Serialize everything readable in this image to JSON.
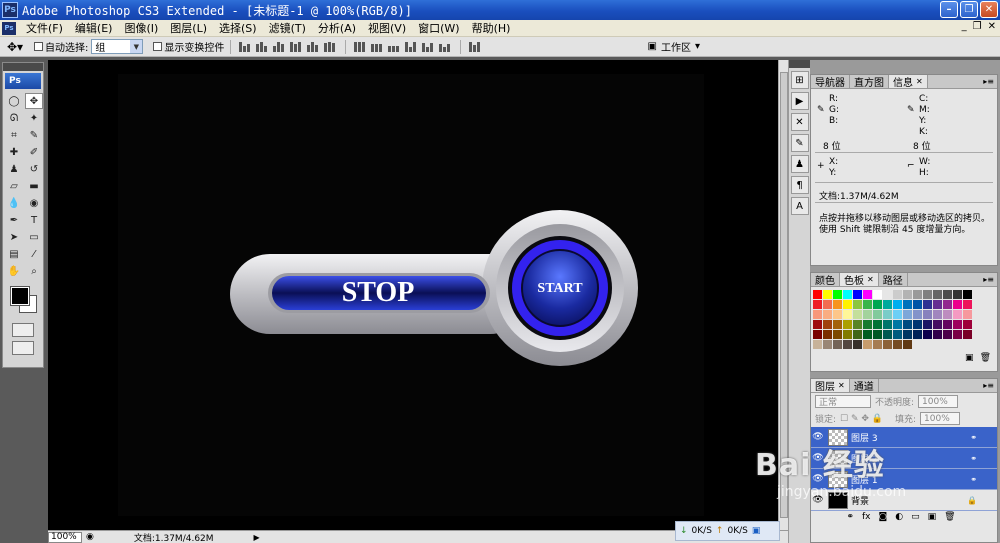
{
  "window": {
    "title": "Adobe Photoshop CS3 Extended - [未标题-1 @ 100%(RGB/8)]",
    "app_badge": "Ps"
  },
  "menu": {
    "items": [
      "文件(F)",
      "编辑(E)",
      "图像(I)",
      "图层(L)",
      "选择(S)",
      "滤镜(T)",
      "分析(A)",
      "视图(V)",
      "窗口(W)",
      "帮助(H)"
    ]
  },
  "options": {
    "auto_select_label": "自动选择:",
    "auto_select_value": "组",
    "show_transform_label": "显示变换控件",
    "workspace_label": "工作区"
  },
  "toolbox": {
    "badge": "Ps"
  },
  "canvas": {
    "stop_label": "STOP",
    "start_label": "START",
    "colors": {
      "bar_blue": "#2a3fd6",
      "ring_blue": "#3322ee",
      "silver": "#cfcfd4"
    }
  },
  "status": {
    "zoom": "100%",
    "doc_size": "文档:1.37M/4.62M",
    "net_down": "0K/S",
    "net_up": "0K/S"
  },
  "info_panel": {
    "tabs": [
      "导航器",
      "直方图",
      "信息"
    ],
    "r": "R:",
    "g": "G:",
    "b": "B:",
    "c": "C:",
    "m": "M:",
    "y": "Y:",
    "k": "K:",
    "bits_left": "8 位",
    "bits_right": "8 位",
    "x": "X:",
    "y2": "Y:",
    "w": "W:",
    "h": "H:",
    "doc_size": "文档:1.37M/4.62M",
    "hint_line1": "点按并拖移以移动图层或移动选区的拷贝。",
    "hint_line2": "使用 Shift 键限制沿 45 度增量方向。"
  },
  "swatch_panel": {
    "tabs": [
      "颜色",
      "色板",
      "路径"
    ],
    "colors": [
      "#ff0000",
      "#ffff00",
      "#00ff00",
      "#00ffff",
      "#0000ff",
      "#ff00ff",
      "#ffffff",
      "#e6e6e6",
      "#cccccc",
      "#b3b3b3",
      "#999999",
      "#808080",
      "#666666",
      "#4d4d4d",
      "#333333",
      "#000000",
      "#ee1d24",
      "#f26c4f",
      "#f7941d",
      "#fff200",
      "#8dc63f",
      "#39b54a",
      "#00a651",
      "#00a99d",
      "#00aeef",
      "#0072bc",
      "#0054a6",
      "#2e3192",
      "#662d91",
      "#92278f",
      "#ec008c",
      "#ed145b",
      "#f7977a",
      "#f9ad81",
      "#fdc689",
      "#fff799",
      "#c4df9b",
      "#a3d39c",
      "#82ca9c",
      "#7accc8",
      "#6dcff6",
      "#7da7d9",
      "#8393ca",
      "#8781bd",
      "#a186be",
      "#bd8cbf",
      "#f49ac2",
      "#f6989d",
      "#9e0b0f",
      "#a0410d",
      "#a36209",
      "#aba000",
      "#598527",
      "#197b30",
      "#007236",
      "#00746b",
      "#0076a3",
      "#004b80",
      "#003471",
      "#1b1464",
      "#440e62",
      "#630460",
      "#9e005d",
      "#9e0039",
      "#790000",
      "#7b2e00",
      "#7d4900",
      "#827b00",
      "#406618",
      "#005e20",
      "#005826",
      "#005952",
      "#005b7f",
      "#003663",
      "#002157",
      "#0d004c",
      "#32004b",
      "#4b0049",
      "#7b0046",
      "#7a0026",
      "#c7b299",
      "#998675",
      "#736357",
      "#534741",
      "#37302a",
      "#c69c6d",
      "#a67c52",
      "#8c6239",
      "#754c24",
      "#603913"
    ]
  },
  "layers_panel": {
    "tabs": [
      "图层",
      "通道"
    ],
    "blend_mode": "正常",
    "opacity_label": "不透明度:",
    "opacity_value": "100%",
    "lock_label": "锁定:",
    "fill_label": "填充:",
    "fill_value": "100%",
    "layers": [
      "图层 3",
      "图层 2",
      "图层 1",
      "背景"
    ]
  },
  "watermark": {
    "main": "Bai 经验",
    "sub": "jingyan.baidu.com"
  }
}
